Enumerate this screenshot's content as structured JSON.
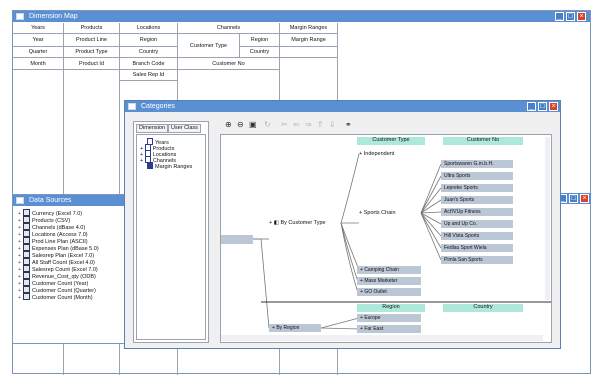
{
  "dimension_map": {
    "title": "Dimension Map",
    "grid": {
      "row1": [
        "Years",
        "Products",
        "Locations",
        "Channels",
        "Margin Ranges"
      ],
      "row2": [
        "Year",
        "Product Line",
        "Region",
        "Customer Type",
        "Region",
        "Margin Range"
      ],
      "row3": [
        "Quarter",
        "Product Type",
        "Country",
        "Country"
      ],
      "row4": [
        "Month",
        "Product Id",
        "Branch Code",
        "Customer No"
      ],
      "row5": [
        "Sales Rep Id"
      ]
    }
  },
  "data_sources": {
    "title": "Data Sources",
    "items": [
      "Currency (Excel 7.0)",
      "Products (CSV)",
      "Channels (dBase 4.0)",
      "Locations (Access 7.0)",
      "Prod Line Plan (ASCII)",
      "Expenses Plan (dBase 5.0)",
      "Salesrep Plan (Excel 7.0)",
      "All Staff Count (Excel 4.0)",
      "Salesrep Count (Excel 7.0)",
      "Revenue_Cost_qty (ODB)",
      "Customer Count (Year)",
      "Customer Count (Quarter)",
      "Customer Count (Month)"
    ]
  },
  "categories": {
    "title": "Categories",
    "tabs": [
      "Dimension",
      "User Class"
    ],
    "tree": [
      "Years",
      "Products",
      "Locations",
      "Channels",
      "Margin Ranges"
    ],
    "upper": {
      "branch": "By Customer Type",
      "headers": [
        "Customer Type",
        "Customer No"
      ],
      "types": [
        "Independent",
        "Sports Chain",
        "Camping Chain",
        "Mass Marketer",
        "GO Outlet"
      ],
      "customers": [
        "Sportswaren G.m.b.H.",
        "Ultra Sports",
        "Lepreke Sports",
        "Juan's Sports",
        "Act'N'Up Fitness",
        "Up and Up Co.",
        "Hill Vista Sports",
        "Fedlau Sport Wiela",
        "Pimla San Sports"
      ]
    },
    "lower": {
      "branch": "By Region",
      "headers": [
        "Region",
        "Country"
      ],
      "regions": [
        "Europe",
        "Far East"
      ]
    }
  },
  "colors": {
    "titlebar": "#5a8fd4",
    "header_fill": "#aee8da",
    "member_fill": "#bcc7d6",
    "close_button": "#d9452c"
  }
}
